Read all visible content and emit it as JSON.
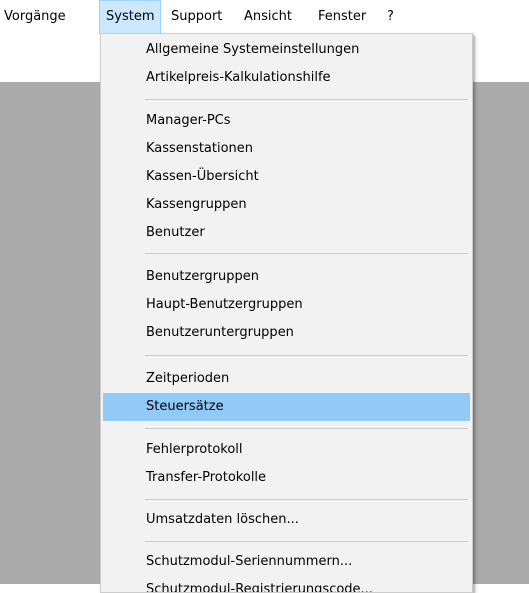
{
  "menubar": {
    "items": [
      "Vorgänge",
      "System",
      "Support",
      "Ansicht",
      "Fenster",
      "?"
    ],
    "active": "System"
  },
  "menu": {
    "groups": [
      [
        "Allgemeine Systemeinstellungen",
        "Artikelpreis-Kalkulationshilfe"
      ],
      [
        "Manager-PCs",
        "Kassenstationen",
        "Kassen-Übersicht",
        "Kassengruppen",
        "Benutzer"
      ],
      [
        "Benutzergruppen",
        "Haupt-Benutzergruppen",
        "Benutzeruntergruppen"
      ],
      [
        "Zeitperioden",
        "Steuersätze"
      ],
      [
        "Fehlerprotokoll",
        "Transfer-Protokolle"
      ],
      [
        "Umsatzdaten löschen..."
      ],
      [
        "Schutzmodul-Seriennummern...",
        "Schutzmodul-Registrierungscode..."
      ]
    ],
    "highlighted": "Steuersätze"
  },
  "colors": {
    "menu_highlight": "#91c9f7",
    "menubar_active": "#cce8ff",
    "client_background": "#ababab"
  }
}
